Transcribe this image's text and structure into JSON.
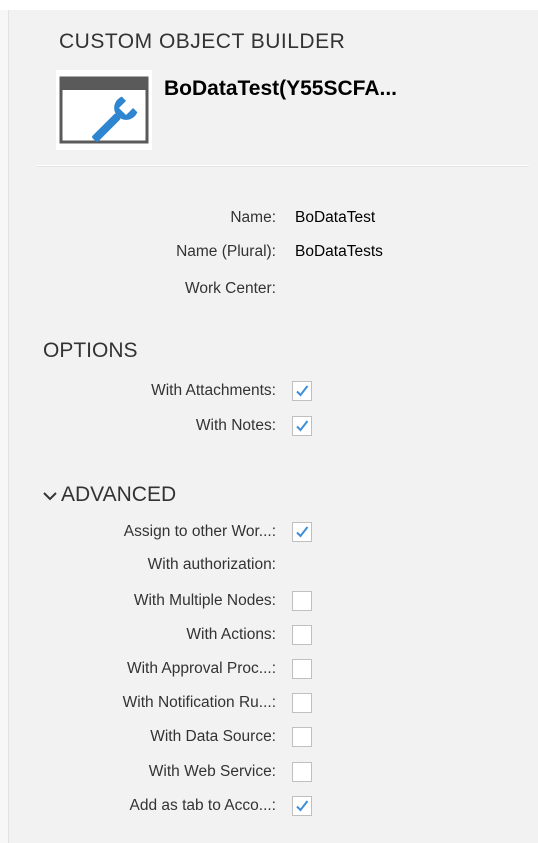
{
  "header": {
    "title": "CUSTOM OBJECT BUILDER",
    "object_name": "BoDataTest(Y55SCFA..."
  },
  "details": {
    "fields": [
      {
        "label": "Name:",
        "value": "BoDataTest"
      },
      {
        "label": "Name (Plural):",
        "value": "BoDataTests"
      },
      {
        "label": "Work Center:",
        "value": ""
      }
    ]
  },
  "options": {
    "title": "OPTIONS",
    "items": [
      {
        "label": "With Attachments:",
        "checked": true
      },
      {
        "label": "With Notes:",
        "checked": true
      }
    ]
  },
  "advanced": {
    "title": "ADVANCED",
    "items": [
      {
        "label": "Assign to other Wor...:",
        "checked": true
      },
      {
        "label": "With authorization:",
        "checked": null
      },
      {
        "label": "With Multiple Nodes:",
        "checked": false
      },
      {
        "label": "With Actions:",
        "checked": false
      },
      {
        "label": "With Approval Proc...:",
        "checked": false
      },
      {
        "label": "With Notification Ru...:",
        "checked": false
      },
      {
        "label": "With Data Source:",
        "checked": false
      },
      {
        "label": "With Web Service:",
        "checked": false
      },
      {
        "label": "Add as tab to Acco...:",
        "checked": true
      }
    ]
  },
  "colors": {
    "check": "#3f8fd8",
    "panel_bg": "#f2f2f2",
    "icon_blue": "#2f86d0",
    "icon_gray": "#5a5a5a"
  },
  "icons": {
    "object": "wrench-window-icon",
    "check": "checkmark-icon",
    "expand": "chevron-down-icon"
  }
}
